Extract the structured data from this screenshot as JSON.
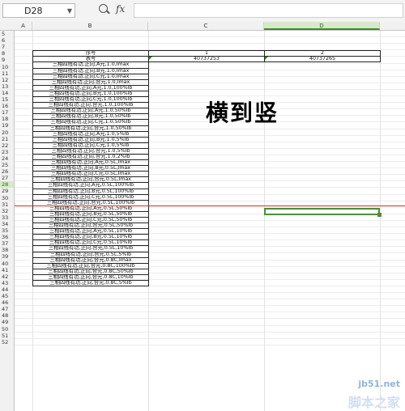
{
  "formula_bar": {
    "cell_ref": "D28",
    "function_label": "fx",
    "formula": ""
  },
  "columns": [
    "A",
    "B",
    "C",
    "D"
  ],
  "selected_column": "D",
  "rows": [
    "5",
    "6",
    "7",
    "8",
    "9",
    "10",
    "11",
    "12",
    "13",
    "14",
    "15",
    "16",
    "17",
    "18",
    "19",
    "20",
    "21",
    "22",
    "23",
    "24",
    "25",
    "26",
    "27",
    "28",
    "29",
    "30",
    "31",
    "32",
    "33",
    "34",
    "35",
    "36",
    "37",
    "38",
    "39",
    "40",
    "41",
    "42",
    "43",
    "44",
    "45",
    "46",
    "47",
    "48",
    "49",
    "50",
    "51",
    "52"
  ],
  "selected_row": "28",
  "table": {
    "header_row": {
      "label": "序号",
      "c": "1",
      "d": "2"
    },
    "meter_row": {
      "label": "表号",
      "c": "40737253",
      "d": "40737265"
    },
    "items": [
      "三相四线有功,正向,A元,1.0,Imax",
      "三相四线有功,正向,B元,1.0,Imax",
      "三相四线有功,正向,C元,1.0,Imax",
      "三相四线有功,正向,合元,1.0,Imax",
      "三相四线有功,正向,A元,1.0,100%Ib",
      "三相四线有功,正向,B元,1.0,100%Ib",
      "三相四线有功,正向,C元,1.0,100%Ib",
      "三相四线有功,正向,合元,1.0,100%Ib",
      "三相四线有功,正向,A元,1.0,50%Ib",
      "三相四线有功,正向,B元,1.0,50%Ib",
      "三相四线有功,正向,C元,1.0,50%Ib",
      "三相四线有功,正向,合元,1.0,50%Ib",
      "三相四线有功,正向,A元,1.0,5%Ib",
      "三相四线有功,正向,B元,1.0,5%Ib",
      "三相四线有功,正向,C元,1.0,5%Ib",
      "三相四线有功,正向,合元,1.0,5%Ib",
      "三相四线有功,正向,合元,1.0,2%Ib",
      "三相四线有功,正向,A元,0.5L,Imax",
      "三相四线有功,正向,B元,0.5L,Imax",
      "三相四线有功,正向,C元,0.5L,Imax",
      "三相四线有功,正向,合元,0.5L,Imax",
      "三相四线有功,正向,A元,0.5L,100%Ib",
      "三相四线有功,正向,B元,0.5L,100%Ib",
      "三相四线有功,正向,C元,0.5L,100%Ib",
      "三相四线有功,正向,合元,0.5L,100%Ib",
      "三相四线有功,正向,A元,0.5L,50%Ib",
      "三相四线有功,正向,B元,0.5L,50%Ib",
      "三相四线有功,正向,C元,0.5L,50%Ib",
      "三相四线有功,正向,合元,0.5L,50%Ib",
      "三相四线有功,正向,A元,0.5L,10%Ib",
      "三相四线有功,正向,B元,0.5L,10%Ib",
      "三相四线有功,正向,C元,0.5L,10%Ib",
      "三相四线有功,正向,合元,0.5L,10%Ib",
      "三相四线有功,正向,合元,0.5L,5%Ib",
      "三相四线有功,正向,合元,0.8C,Imax",
      "三相四线有功,正向,合元,0.8C,100%Ib",
      "三相四线有功,正向,合元,0.8C,50%Ib",
      "三相四线有功,正向,合元,0.8C,10%Ib",
      "三相四线有功,正向,合元,0.8C,5%Ib"
    ]
  },
  "overlay_text": "横到竖",
  "watermark": {
    "line1": "jb51.net",
    "line2": "脚本之家"
  },
  "colors": {
    "selection": "#4b8f3a",
    "red_line": "#c0392b"
  }
}
